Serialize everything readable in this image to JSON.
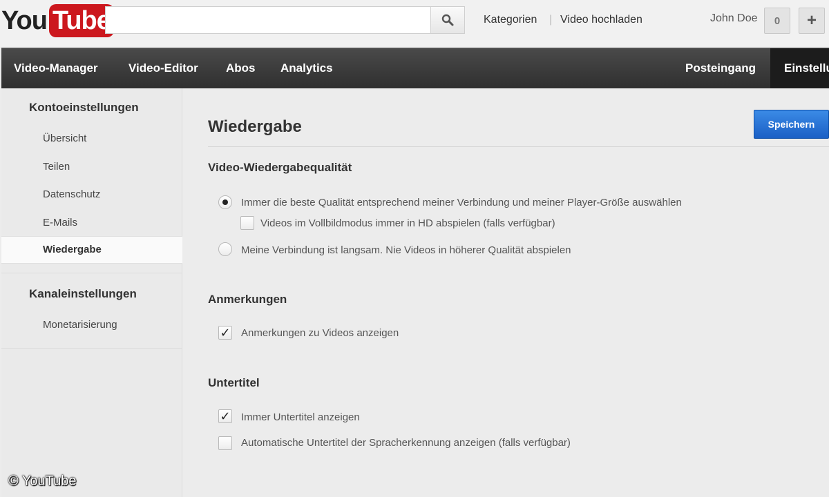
{
  "header": {
    "logo_you": "You",
    "logo_tube": "Tube",
    "search": {
      "value": "",
      "placeholder": ""
    },
    "links": {
      "categories": "Kategorien",
      "separator": "|",
      "upload": "Video hochladen"
    },
    "username": "John Doe",
    "notification_count": "0",
    "plus_label": "+"
  },
  "nav": {
    "items": [
      "Video-Manager",
      "Video-Editor",
      "Abos",
      "Analytics"
    ],
    "inbox": "Posteingang",
    "settings": "Einstellungen"
  },
  "sidebar": {
    "account_heading": "Kontoeinstellungen",
    "account_items": [
      "Übersicht",
      "Teilen",
      "Datenschutz",
      "E-Mails"
    ],
    "active_item": "Wiedergabe",
    "channel_heading": "Kanaleinstellungen",
    "channel_items": [
      "Monetarisierung"
    ]
  },
  "main": {
    "title": "Wiedergabe",
    "save_label": "Speichern",
    "quality": {
      "heading": "Video-Wiedergabequalität",
      "option_best": "Immer die beste Qualität entsprechend meiner Verbindung und meiner Player-Größe auswählen",
      "option_hd": "Videos im Vollbildmodus immer in HD abspielen (falls verfügbar)",
      "option_slow": "Meine Verbindung ist langsam. Nie Videos in höherer Qualität abspielen",
      "best_selected": true,
      "hd_checked": false
    },
    "annotations": {
      "heading": "Anmerkungen",
      "option_show": "Anmerkungen zu Videos anzeigen",
      "show_checked": true
    },
    "subtitles": {
      "heading": "Untertitel",
      "option_always": "Immer Untertitel anzeigen",
      "option_auto": "Automatische Untertitel der Spracherkennung anzeigen (falls verfügbar)",
      "always_checked": true,
      "auto_checked": false
    }
  },
  "watermark": "© YouTube",
  "icons": {
    "search": "search-icon",
    "check": "✓"
  },
  "colors": {
    "brand_red": "#cc181e",
    "save_blue": "#1a5fc5",
    "nav_dark": "#2f2f2f"
  }
}
